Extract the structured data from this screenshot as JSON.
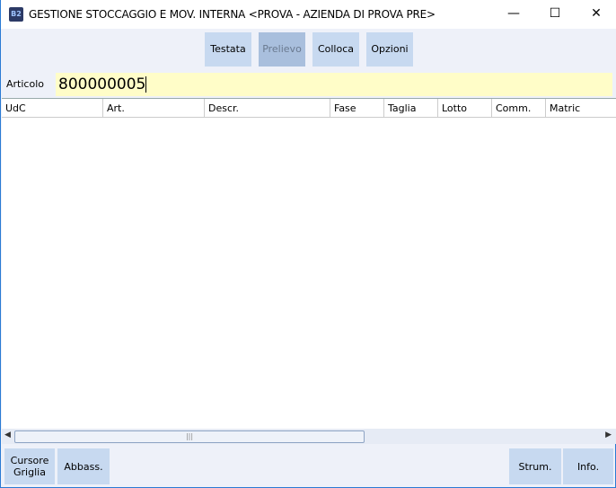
{
  "window": {
    "title": "GESTIONE STOCCAGGIO E MOV. INTERNA <PROVA - AZIENDA DI PROVA PRE>",
    "icon_text": "B2",
    "minimize": "—",
    "maximize": "☐",
    "close": "✕"
  },
  "toolbar": {
    "testata": "Testata",
    "prelievo": "Prelievo",
    "colloca": "Colloca",
    "opzioni": "Opzioni"
  },
  "articolo": {
    "label": "Articolo",
    "value": "800000005"
  },
  "grid": {
    "columns": [
      "UdC",
      "Art.",
      "Descr.",
      "Fase",
      "Taglia",
      "Lotto",
      "Comm.",
      "Matric"
    ],
    "rows": []
  },
  "scroll": {
    "grip": "|||",
    "left": "◀",
    "right": "▶"
  },
  "bottom": {
    "cursore1": "Cursore",
    "cursore2": "Griglia",
    "abbass": "Abbass.",
    "strum": "Strum.",
    "info": "Info."
  }
}
